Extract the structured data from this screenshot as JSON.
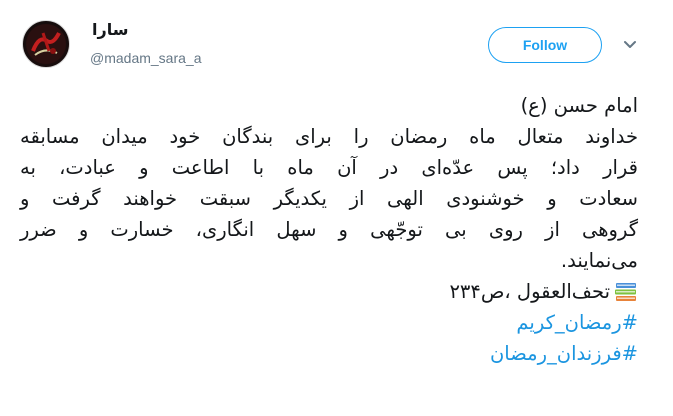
{
  "tweet": {
    "author": {
      "display_name": "سارا",
      "handle": "@madam_sara_a"
    },
    "follow_label": "Follow",
    "body_lines": [
      "امام حسن (ع)",
      "خداوند متعال ماه رمضان را برای بندگان خود میدان مسابقه",
      "قرار داد؛ پس عدّه‌ای در آن ماه با اطاعت و عبادت، به",
      "سعادت و خوشنودی الهی از یکدیگر سبقت خواهند گرفت و",
      "گروهی از روی بی توجّهی و سهل انگاری، خسارت و ضرر",
      "می‌نمایند."
    ],
    "source_text": "تحف‌العقول ،ص۲۳۴",
    "hashtags": [
      "#رمضان_کریم",
      "#فرزندان_رمضان"
    ]
  },
  "icons": {
    "caret": "chevron-down-icon",
    "books": "books-emoji-icon"
  },
  "colors": {
    "accent": "#1da1f2",
    "hashtag": "#1b95e0",
    "text": "#14171a",
    "muted": "#657786"
  }
}
